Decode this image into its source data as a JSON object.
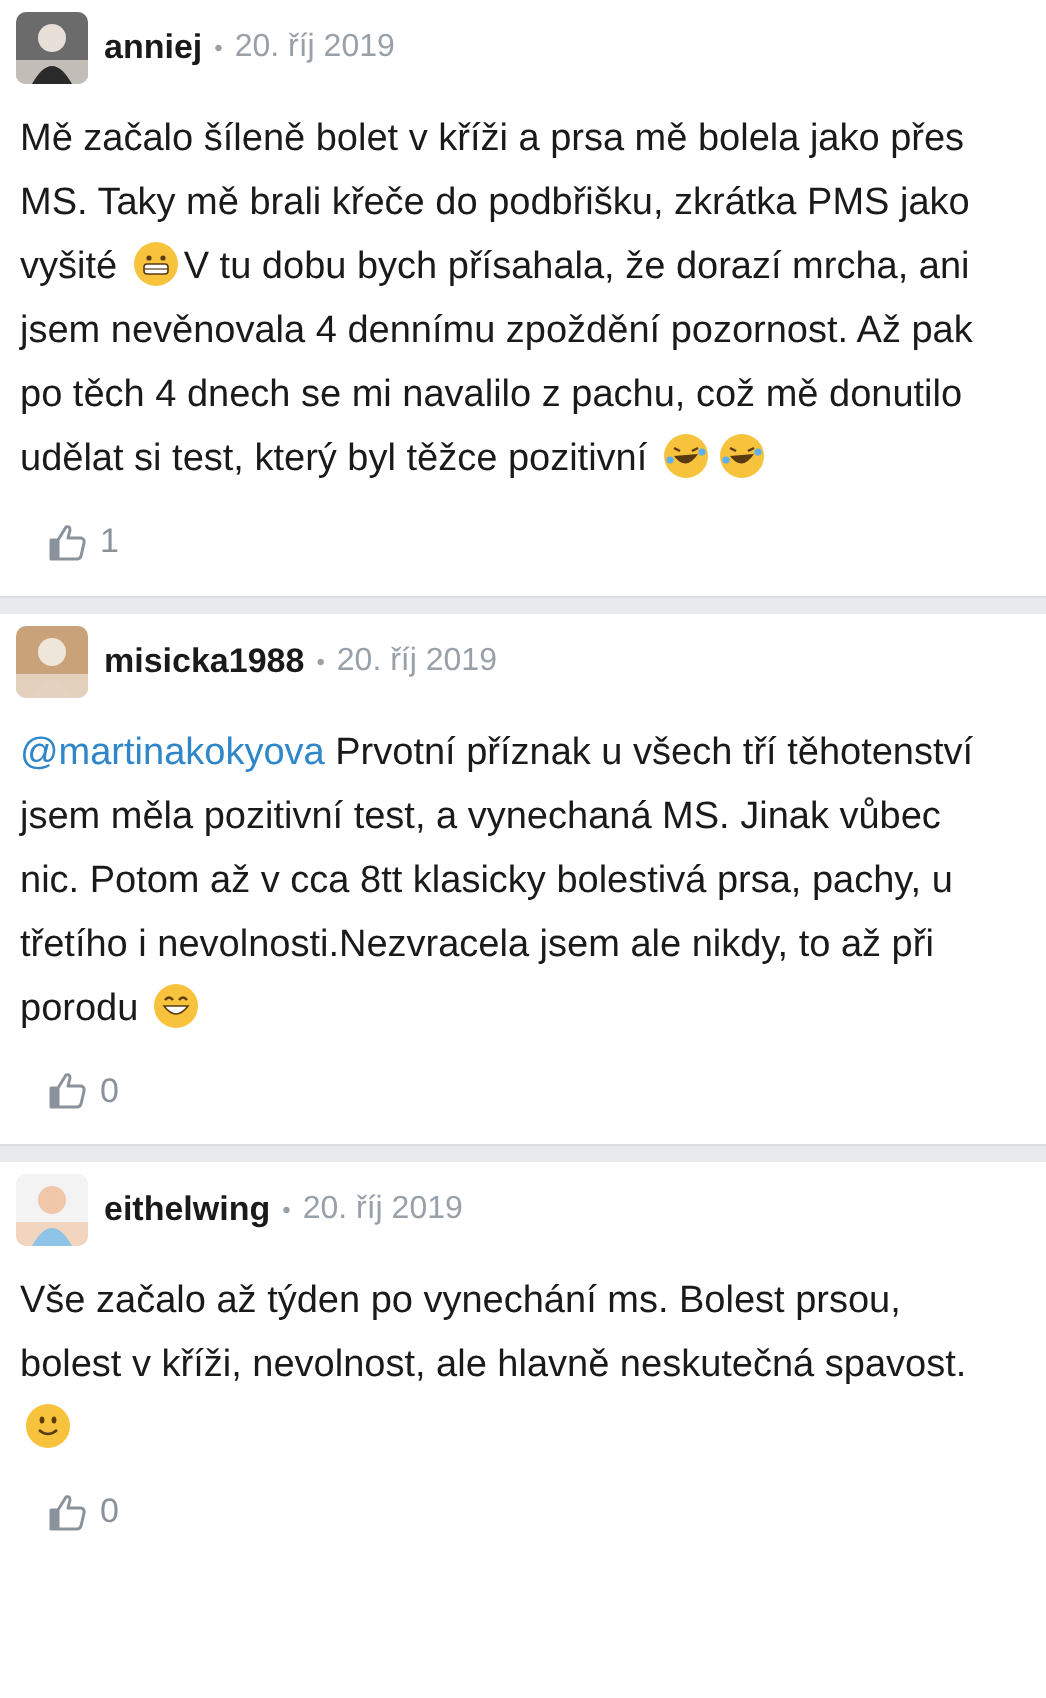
{
  "comments": [
    {
      "author": "anniej",
      "separator": "•",
      "date": "20. říj 2019",
      "avatar": {
        "kind": "picture"
      },
      "body": [
        {
          "kind": "text",
          "text": "Mě začalo šíleně bolet v kříži a prsa mě bolela jako přes MS. Taky mě brali křeče do podbřišku, zkrátka PMS jako vyšité"
        },
        {
          "kind": "grimacing"
        },
        {
          "kind": "text",
          "text": "V tu dobu bych přísahala, že dorazí mrcha, ani jsem nevěnovala 4 dennímu zpoždění pozornost. Až pak po těch 4 dnech se mi navalilo z pachu, což mě donutilo udělat si test, který byl těžce pozitivní"
        },
        {
          "kind": "rofl"
        },
        {
          "kind": "rofl"
        }
      ],
      "likes": "1"
    },
    {
      "author": "misicka1988",
      "separator": "•",
      "date": "20. říj 2019",
      "avatar": {
        "kind": "picture"
      },
      "body": [
        {
          "kind": "mention",
          "text": "@martinakokyova"
        },
        {
          "kind": "text",
          "text": "Prvotní příznak u všech tří těhotenství jsem měla pozitivní test, a vynechaná MS. Jinak vůbec nic. Potom až v cca 8tt klasicky bolestivá prsa, pachy, u třetího i nevolnosti.Nezvracela jsem ale nikdy, to až při porodu"
        },
        {
          "kind": "grin"
        }
      ],
      "likes": "0"
    },
    {
      "author": "eithelwing",
      "separator": "•",
      "date": "20. říj 2019",
      "avatar": {
        "kind": "picture"
      },
      "body": [
        {
          "kind": "text",
          "text": "Vše začalo až týden po vynechání ms. Bolest prsou, bolest v kříži, nevolnost, ale hlavně neskutečná spavost."
        },
        {
          "kind": "smile"
        }
      ],
      "likes": "0"
    }
  ]
}
